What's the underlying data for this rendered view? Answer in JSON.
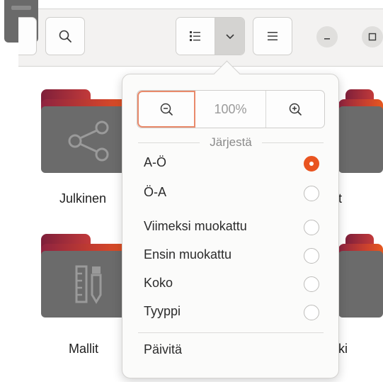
{
  "toolbar": {
    "search_icon": "search-icon",
    "view_list_icon": "list-view-icon",
    "view_dropdown_icon": "chevron-down-icon",
    "menu_icon": "hamburger-menu-icon",
    "minimize_icon": "minimize-icon",
    "maximize_icon": "maximize-icon"
  },
  "folders": [
    {
      "label": "Julkinen",
      "icon": "share-icon"
    },
    {
      "label": "t",
      "icon": "folder-icon"
    },
    {
      "label": "Mallit",
      "icon": "templates-icon"
    },
    {
      "label": "ki",
      "icon": "folder-icon"
    }
  ],
  "popover": {
    "zoom_out_icon": "zoom-out-icon",
    "zoom_level": "100%",
    "zoom_in_icon": "zoom-in-icon",
    "sort_section_title": "Järjestä",
    "sort_options": [
      {
        "label": "A-Ö",
        "selected": true
      },
      {
        "label": "Ö-A",
        "selected": false
      },
      {
        "label": "Viimeksi muokattu",
        "selected": false
      },
      {
        "label": "Ensin muokattu",
        "selected": false
      },
      {
        "label": "Koko",
        "selected": false
      },
      {
        "label": "Tyyppi",
        "selected": false
      }
    ],
    "refresh_label": "Päivitä"
  },
  "colors": {
    "accent": "#e95420",
    "folder_gradient_start": "#7e1f3a",
    "folder_gradient_end": "#e6581f",
    "folder_body": "#6b6b6b"
  }
}
